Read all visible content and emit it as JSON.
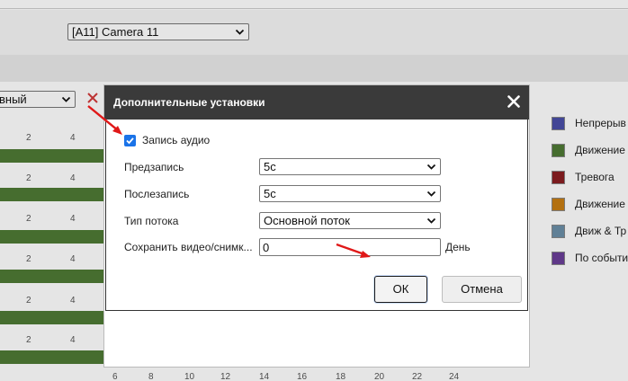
{
  "background": {
    "camera_select": "[A11] Camera 11",
    "mode_select": "вный",
    "ticks_top": [
      "2",
      "4"
    ],
    "ticks_bottom": [
      "6",
      "8",
      "10",
      "12",
      "14",
      "16",
      "18",
      "20",
      "22",
      "24"
    ],
    "legend": [
      {
        "label": "Непрерыв",
        "color": "#4a4fa8"
      },
      {
        "label": "Движение",
        "color": "#4e7a35"
      },
      {
        "label": "Тревога",
        "color": "#8a1f22"
      },
      {
        "label": "Движение",
        "color": "#c87d12"
      },
      {
        "label": "Движ & Тр",
        "color": "#6b8fa8"
      },
      {
        "label": "По событи",
        "color": "#6a3f98"
      }
    ]
  },
  "dialog": {
    "title": "Дополнительные установки",
    "audio_checkbox_label": "Запись аудио",
    "audio_checked": true,
    "rows": [
      {
        "label": "Предзапись",
        "value": "5с"
      },
      {
        "label": "Послезапись",
        "value": "5с"
      },
      {
        "label": "Тип потока",
        "value": "Основной поток"
      }
    ],
    "save_label": "Сохранить видео/снимк...",
    "save_value": "0",
    "save_unit": "День",
    "ok_label": "ОК",
    "cancel_label": "Отмена"
  },
  "colors": {
    "header": "#3a3a3a",
    "checkbox": "#1a73e8",
    "annotation_arrow": "#e01818"
  }
}
